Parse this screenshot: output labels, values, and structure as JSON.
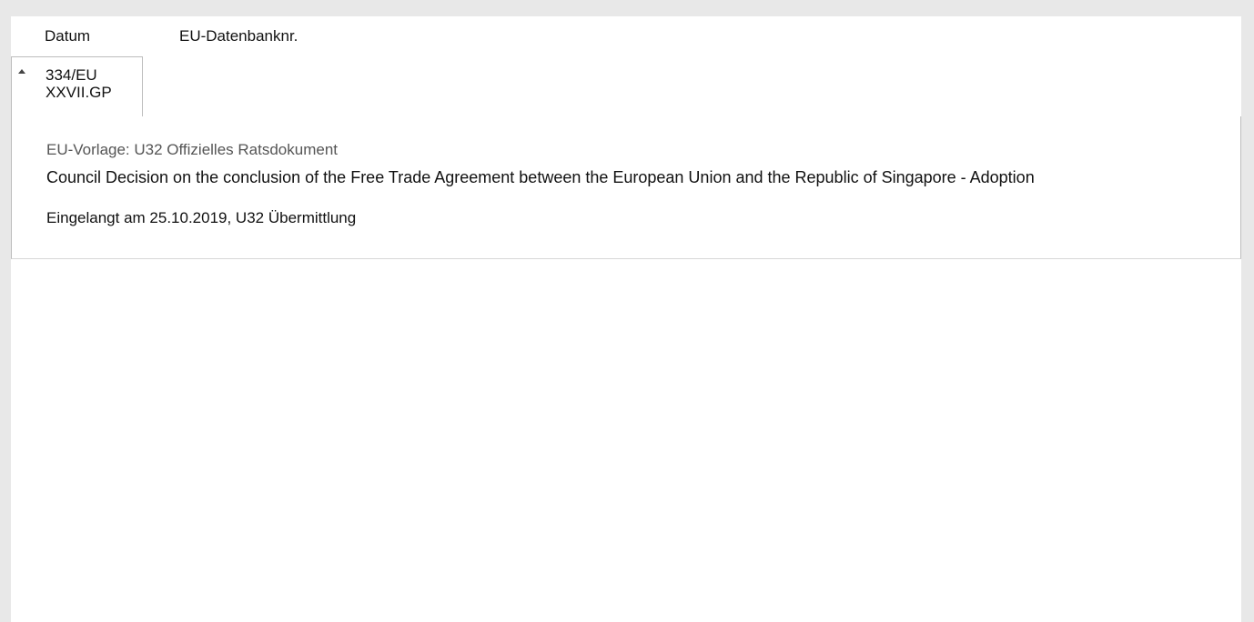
{
  "table": {
    "headers": {
      "date": "Datum",
      "eu_number": "EU-Datenbanknr."
    }
  },
  "row": {
    "number_line1": "334/EU",
    "number_line2": "XXVII.GP",
    "toggle_icon": "collapse-triangle-up",
    "detail": {
      "subtitle": "EU-Vorlage: U32 Offizielles Ratsdokument",
      "title": "Council Decision on the conclusion of the Free Trade Agreement between the European Union and the Republic of Singapore - Adoption",
      "received": "Eingelangt am 25.10.2019, U32 Übermittlung"
    }
  }
}
